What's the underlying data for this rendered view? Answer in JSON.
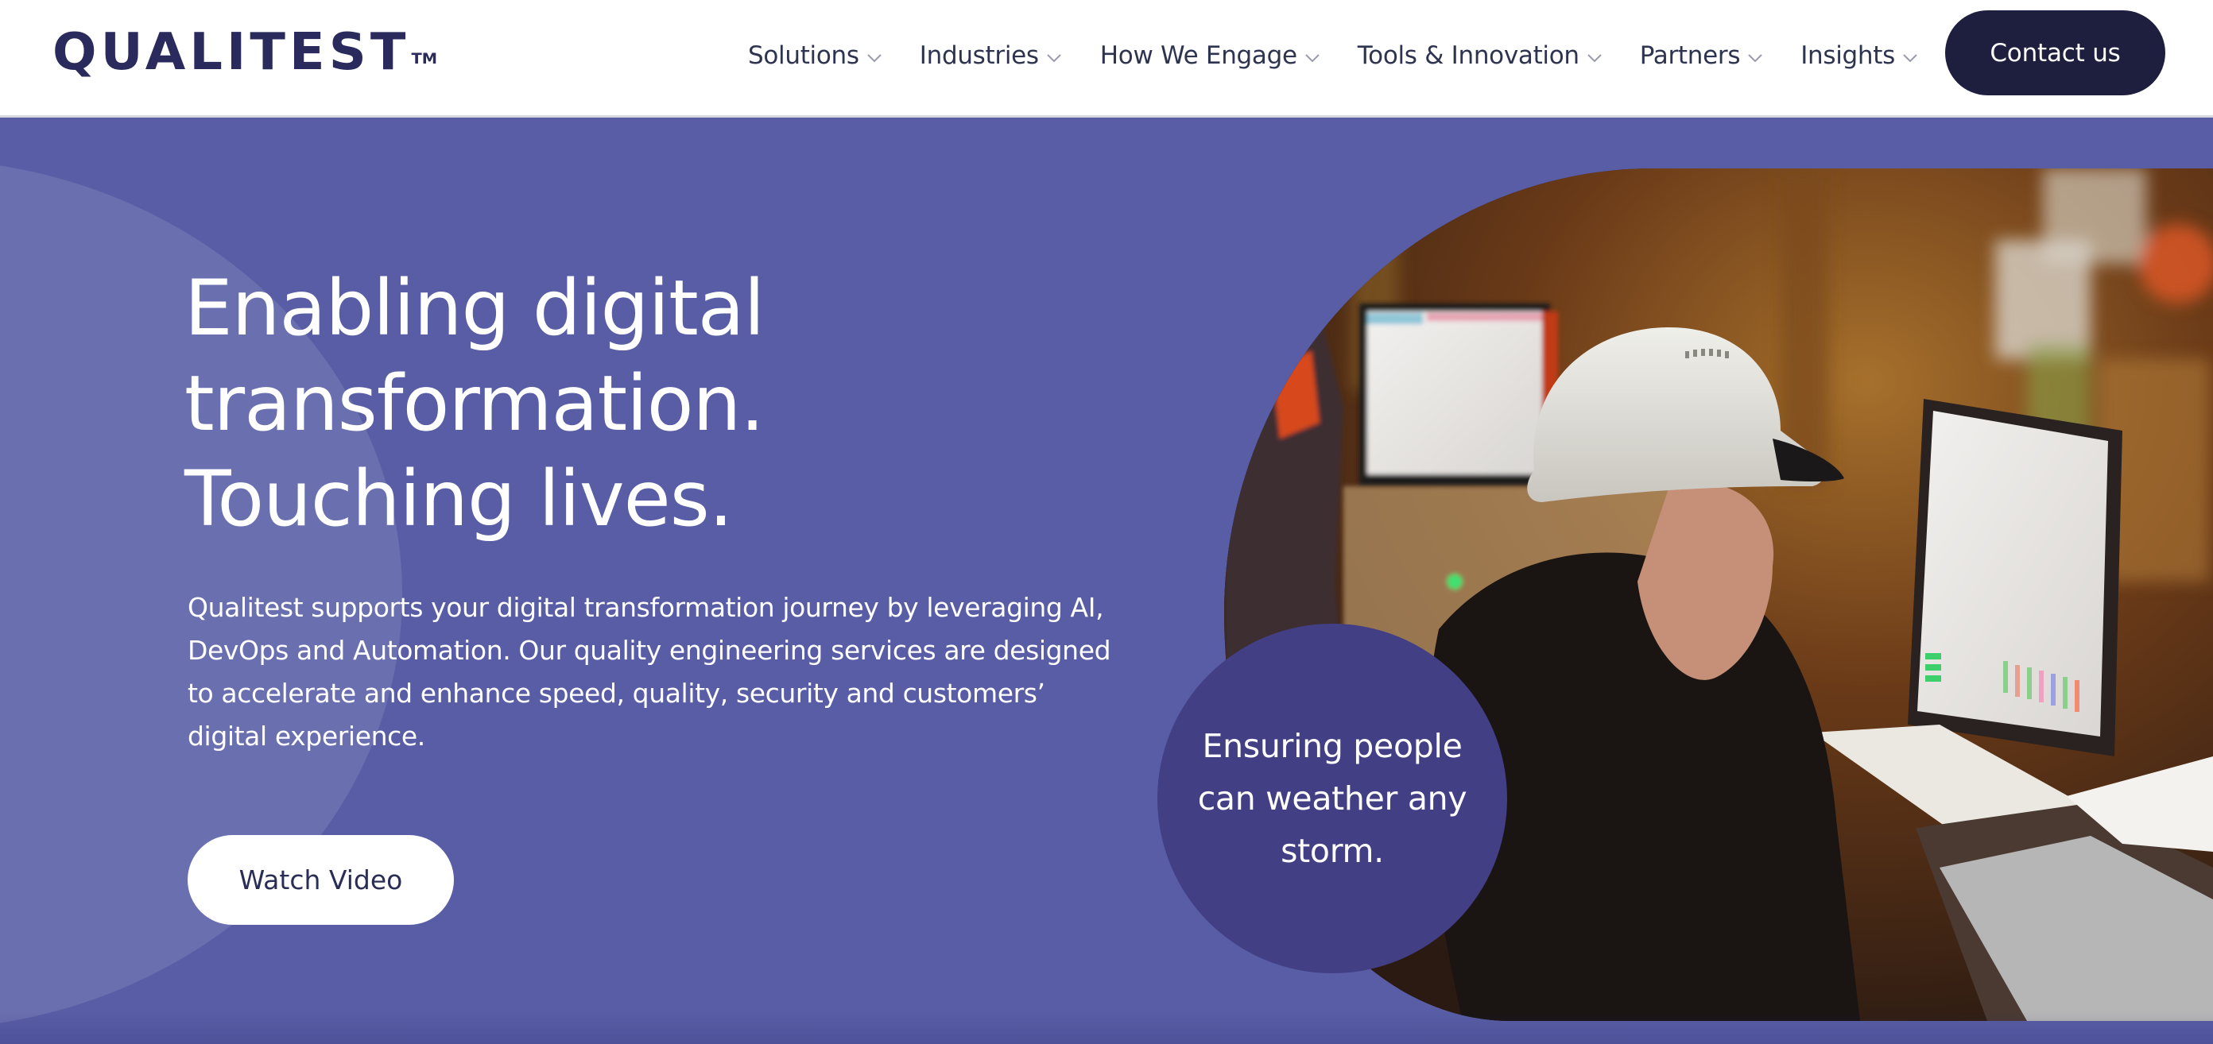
{
  "brand": {
    "name": "QUALITEST",
    "trademark": "TM",
    "color": "#2a2a5c"
  },
  "nav": {
    "items": [
      {
        "label": "Solutions",
        "icon": "chevron-down-icon"
      },
      {
        "label": "Industries",
        "icon": "chevron-down-icon"
      },
      {
        "label": "How We Engage",
        "icon": "chevron-down-icon"
      },
      {
        "label": "Tools & Innovation",
        "icon": "chevron-down-icon"
      },
      {
        "label": "Partners",
        "icon": "chevron-down-icon"
      },
      {
        "label": "Insights",
        "icon": "chevron-down-icon"
      }
    ],
    "contact_label": "Contact us"
  },
  "hero": {
    "headline_lines": [
      "Enabling digital",
      "transformation.",
      "Touching lives."
    ],
    "lead_lines": [
      "Qualitest supports your digital transformation journey by leveraging AI,",
      "DevOps and Automation. Our quality engineering services are designed",
      "to accelerate and enhance speed, quality, security and customers’",
      "digital experience."
    ],
    "watch_video_label": "Watch Video",
    "photo_description": "Worker in white hard hat monitoring control room screens",
    "quote_lines": [
      "Ensuring people",
      "can weather any",
      "storm."
    ]
  },
  "colors": {
    "hero_background": "#585da5",
    "hero_circle": "#6a6fb0",
    "quote_circle": "#423f85",
    "contact_button": "#1e1f3f",
    "nav_text": "#2e3450"
  }
}
